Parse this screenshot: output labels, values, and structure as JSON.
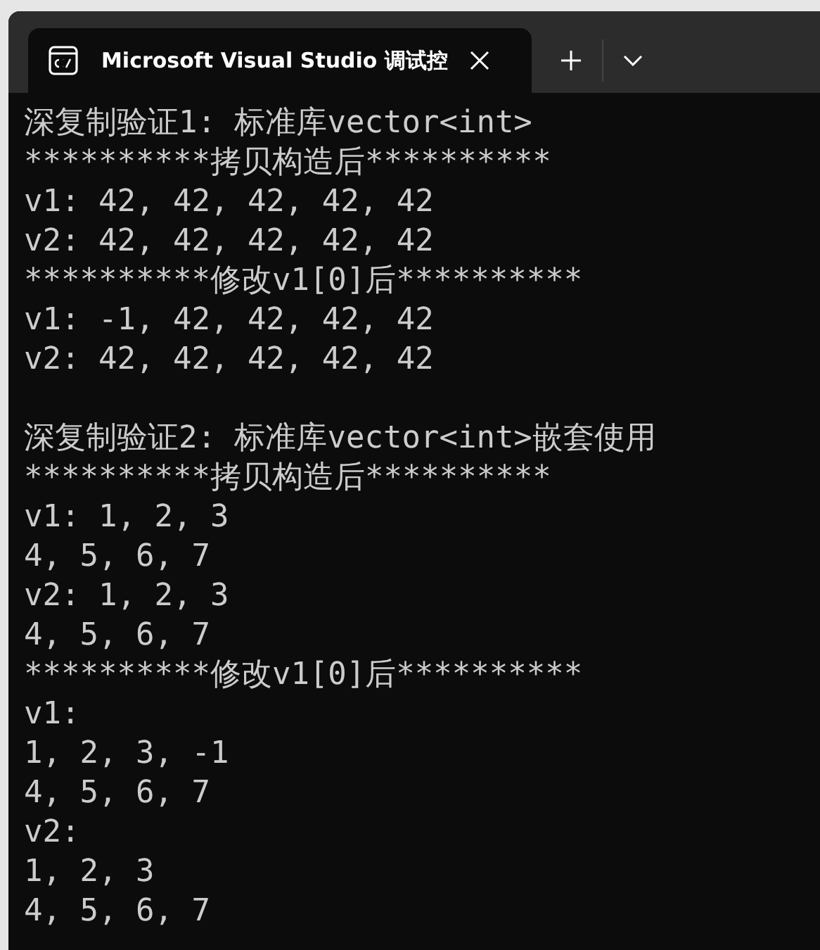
{
  "tab": {
    "title": "Microsoft Visual Studio 调试控",
    "selected": true
  },
  "console": {
    "blocks": [
      {
        "lines": [
          "深复制验证1: 标准库vector<int>",
          "**********拷贝构造后**********",
          "v1: 42, 42, 42, 42, 42",
          "v2: 42, 42, 42, 42, 42",
          "**********修改v1[0]后**********",
          "v1: -1, 42, 42, 42, 42",
          "v2: 42, 42, 42, 42, 42"
        ]
      },
      {
        "lines": [
          "深复制验证2: 标准库vector<int>嵌套使用",
          "**********拷贝构造后**********",
          "v1: 1, 2, 3",
          "4, 5, 6, 7",
          "v2: 1, 2, 3",
          "4, 5, 6, 7",
          "**********修改v1[0]后**********",
          "v1:",
          "1, 2, 3, -1",
          "4, 5, 6, 7",
          "v2:",
          "1, 2, 3",
          "4, 5, 6, 7"
        ]
      }
    ]
  }
}
